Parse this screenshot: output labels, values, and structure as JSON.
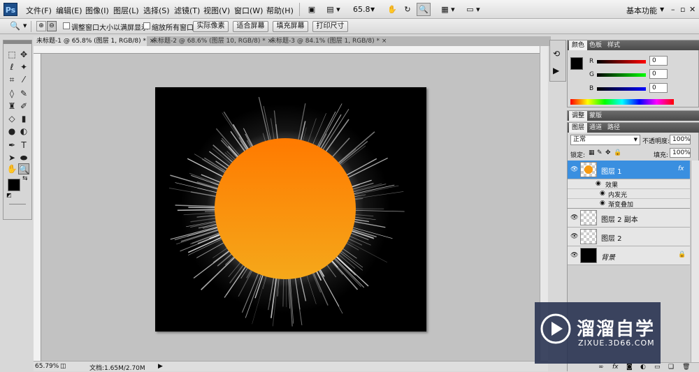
{
  "app": {
    "logo": "Ps"
  },
  "menu": [
    "文件(F)",
    "编辑(E)",
    "图像(I)",
    "图层(L)",
    "选择(S)",
    "滤镜(T)",
    "视图(V)",
    "窗口(W)",
    "帮助(H)"
  ],
  "menubar": {
    "zoom": "65.8",
    "workspace": "基本功能"
  },
  "options": {
    "chk1": "调整窗口大小以满屏显示",
    "chk2": "缩放所有窗口",
    "btn_actual": "实际像素",
    "btn_fit": "适合屏幕",
    "btn_fill": "填充屏幕",
    "btn_print": "打印尺寸"
  },
  "tabs": [
    "未标题-1 @ 65.8% (图层 1, RGB/8) *",
    "未标题-2 @ 68.6% (图层 10, RGB/8) *",
    "未标题-3 @ 84.1% (图层 1, RGB/8) *"
  ],
  "status": {
    "zoom": "65.79%",
    "doc": "文档:1.65M/2.70M"
  },
  "color_panel": {
    "tabs": [
      "颜色",
      "色板",
      "样式"
    ],
    "channels": [
      {
        "label": "R",
        "value": "0"
      },
      {
        "label": "G",
        "value": "0"
      },
      {
        "label": "B",
        "value": "0"
      }
    ]
  },
  "adj_panel": {
    "tabs": [
      "调整",
      "蒙版"
    ]
  },
  "layers_panel": {
    "tabs": [
      "图层",
      "通道",
      "路径"
    ],
    "blend_mode": "正常",
    "opacity_label": "不透明度:",
    "opacity": "100%",
    "lock_label": "锁定:",
    "fill_label": "填充:",
    "fill": "100%",
    "layers": [
      {
        "name": "图层 1",
        "fx": "fx"
      },
      {
        "name": "图层 2 副本"
      },
      {
        "name": "图层 2"
      },
      {
        "name": "背景"
      }
    ],
    "effects_label": "效果",
    "effects": [
      "内发光",
      "渐变叠加"
    ]
  },
  "watermark": {
    "title": "溜溜自学",
    "url": "ZIXUE.3D66.COM"
  },
  "colors": {
    "sun_top": "#ff7a00",
    "sun_bottom": "#f5a81a",
    "selection": "#3a8fe0"
  }
}
